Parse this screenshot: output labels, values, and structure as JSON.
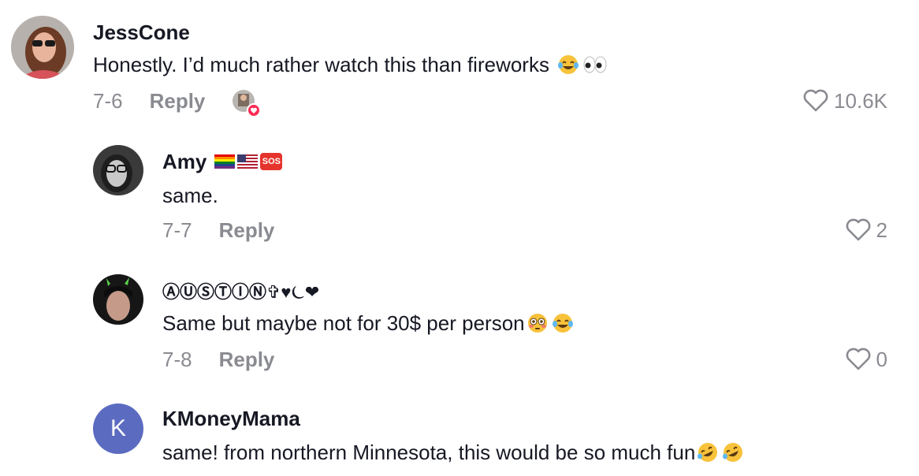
{
  "comments": [
    {
      "username": "JessCone",
      "text": "Honestly. I’d much rather watch this than fireworks",
      "date": "7-6",
      "reply_label": "Reply",
      "likes": "10.6K",
      "emojis": [
        "joy",
        "eyes"
      ]
    },
    {
      "username": "Amy",
      "username_badges": [
        "rainbow-flag",
        "us-flag",
        "sos"
      ],
      "sos_label": "SOS",
      "text": "same.",
      "date": "7-7",
      "reply_label": "Reply",
      "likes": "2"
    },
    {
      "username": "ⒶⓊⓈⓉⒾⓃ✞♥⏾❤",
      "text": "Same but maybe not for 30$ per person",
      "date": "7-8",
      "reply_label": "Reply",
      "likes": "0",
      "emojis": [
        "flushed",
        "joy"
      ]
    },
    {
      "username": "KMoneyMama",
      "avatar_letter": "K",
      "text": "same! from northern Minnesota, this would be so much fun",
      "emojis": [
        "rofl",
        "rofl"
      ]
    }
  ],
  "colors": {
    "text": "#161823",
    "meta": "#8a8b91",
    "avatar_k": "#5b6bc0",
    "liked_badge": "#fe2c55"
  }
}
